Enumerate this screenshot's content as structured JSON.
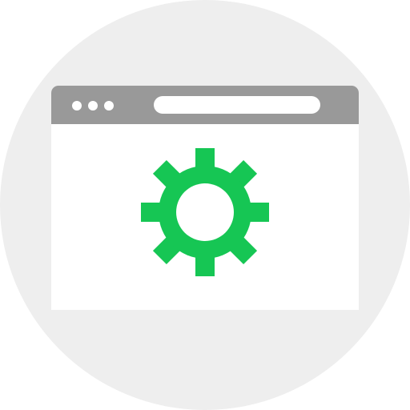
{
  "colors": {
    "background_circle": "#eeeeee",
    "title_bar": "#999999",
    "window": "#ffffff",
    "accent_gear": "#16c654"
  },
  "icons": {
    "window_controls": [
      "dot",
      "dot",
      "dot"
    ],
    "main_icon": "gear-icon"
  }
}
